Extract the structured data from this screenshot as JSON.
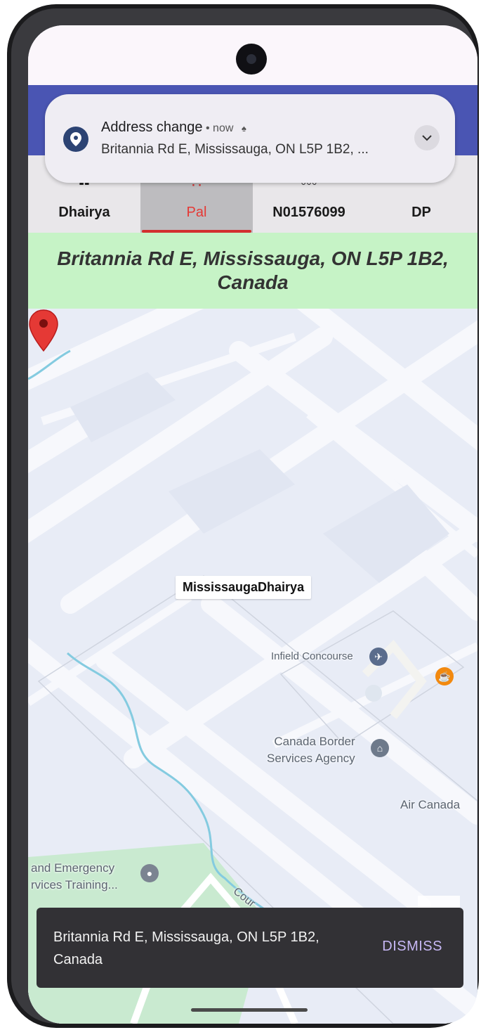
{
  "notification": {
    "title": "Address change",
    "separator": " • ",
    "time": "now",
    "text": "Britannia Rd E, Mississauga, ON L5P 1B2, ..."
  },
  "tabs": [
    {
      "label": "Dhairya",
      "active": false
    },
    {
      "label": "Pal",
      "active": true
    },
    {
      "label": "N01576099",
      "active": false
    },
    {
      "label": "DP",
      "active": false
    }
  ],
  "address_banner": "Britannia Rd E, Mississauga, ON L5P 1B2, Canada",
  "map": {
    "marker_title": "MississaugaDhairya",
    "pois": {
      "infield": "Infield Concourse",
      "cbsa_line1": "Canada Border",
      "cbsa_line2": "Services Agency",
      "air_canada": "Air Canada",
      "training_line1": "and Emergency",
      "training_line2": "rvices Training...",
      "road": "Cour"
    }
  },
  "snackbar": {
    "text": "Britannia Rd E, Mississauga, ON L5P 1B2, Canada",
    "action": "DISMISS"
  },
  "colors": {
    "app_bar": "#4a55b3",
    "active_tab_text": "#e53935",
    "address_banner_bg": "#c6f3c6",
    "marker": "#e53935",
    "snackbar_action": "#c7b8f5"
  }
}
